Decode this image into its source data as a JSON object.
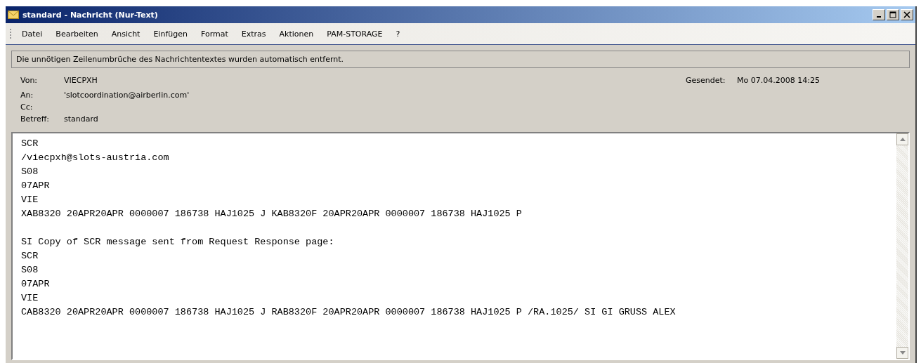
{
  "window": {
    "title": "standard - Nachricht (Nur-Text)"
  },
  "menu": [
    {
      "label": "Datei"
    },
    {
      "label": "Bearbeiten"
    },
    {
      "label": "Ansicht"
    },
    {
      "label": "Einfügen"
    },
    {
      "label": "Format"
    },
    {
      "label": "Extras"
    },
    {
      "label": "Aktionen"
    },
    {
      "label": "PAM-STORAGE"
    },
    {
      "label": "?"
    }
  ],
  "info_bar": "Die unnötigen Zeilenumbrüche des Nachrichtentextes wurden automatisch entfernt.",
  "header": {
    "from": {
      "label": "Von:",
      "value": "VIECPXH"
    },
    "sent": {
      "label": "Gesendet:",
      "value": "Mo 07.04.2008 14:25"
    },
    "fields": [
      {
        "label": "An:",
        "value": "'slotcoordination@airberlin.com'"
      },
      {
        "label": "Cc:"
      },
      {
        "label": "Betreff:",
        "value": "standard"
      }
    ]
  },
  "body": {
    "paragraphs": [
      [
        "SCR",
        "/viecpxh@slots-austria.com",
        "S08",
        "07APR",
        "VIE",
        "XAB8320 20APR20APR 0000007 186738 HAJ1025 J KAB8320F 20APR20APR 0000007 186738 HAJ1025 P"
      ],
      [
        "SI Copy of SCR message sent from Request Response page:",
        "SCR",
        "S08",
        "07APR",
        "VIE",
        "CAB8320 20APR20APR 0000007 186738 HAJ1025 J RAB8320F 20APR20APR 0000007 186738 HAJ1025 P /RA.1025/ SI GI GRUSS ALEX"
      ]
    ]
  }
}
